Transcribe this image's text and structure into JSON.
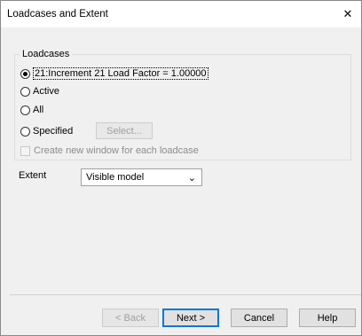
{
  "window": {
    "title": "Loadcases and Extent",
    "close_glyph": "✕"
  },
  "loadcases": {
    "group_label": "Loadcases",
    "options": [
      {
        "label": "21:Increment 21 Load Factor = 1.00000",
        "checked": true
      },
      {
        "label": "Active",
        "checked": false
      },
      {
        "label": "All",
        "checked": false
      },
      {
        "label": "Specified",
        "checked": false
      }
    ],
    "select_button_label": "Select...",
    "new_window_checkbox_label": "Create new window for each loadcase"
  },
  "extent": {
    "label": "Extent",
    "value": "Visible model",
    "chevron": "⌄"
  },
  "buttons": {
    "back": "< Back",
    "next": "Next >",
    "cancel": "Cancel",
    "help": "Help"
  }
}
